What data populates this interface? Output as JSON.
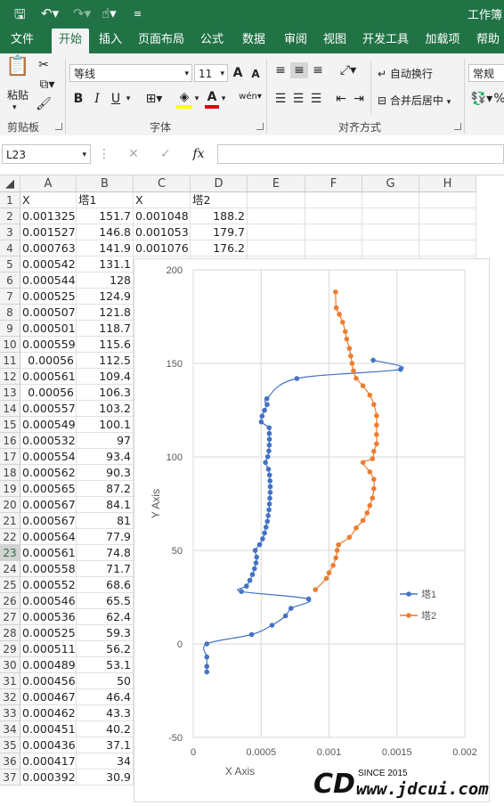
{
  "window": {
    "title": "工作簿"
  },
  "ribbon_tabs": [
    "文件",
    "开始",
    "插入",
    "页面布局",
    "公式",
    "数据",
    "审阅",
    "视图",
    "开发工具",
    "加载项",
    "帮助"
  ],
  "ribbon": {
    "paste_label": "粘贴",
    "clipboard_label": "剪贴板",
    "font_label": "字体",
    "align_label": "对齐方式",
    "font_name": "等线",
    "font_size": "11",
    "bold": "B",
    "italic": "I",
    "underline": "U",
    "font_color_glyph": "A",
    "grow_font": "A",
    "shrink_font": "A",
    "phonetic_glyph": "wén",
    "wrap_text": "自动换行",
    "merge_center": "合并后居中",
    "number_format": "常规",
    "accent_color": "#217346"
  },
  "formula_bar": {
    "name_box": "L23",
    "fx_label": "fx",
    "formula": ""
  },
  "columns": [
    "A",
    "B",
    "C",
    "D",
    "E",
    "F",
    "G",
    "H"
  ],
  "selected_row": 23,
  "rows": [
    {
      "n": "1",
      "a": "X",
      "b": "塔1",
      "c": "X",
      "d": "塔2"
    },
    {
      "n": "2",
      "a": "0.001325",
      "b": "151.7",
      "c": "0.001048",
      "d": "188.2"
    },
    {
      "n": "3",
      "a": "0.001527",
      "b": "146.8",
      "c": "0.001053",
      "d": "179.7"
    },
    {
      "n": "4",
      "a": "0.000763",
      "b": "141.9",
      "c": "0.001076",
      "d": "176.2"
    },
    {
      "n": "5",
      "a": "0.000542",
      "b": "131.1"
    },
    {
      "n": "6",
      "a": "0.000544",
      "b": "128"
    },
    {
      "n": "7",
      "a": "0.000525",
      "b": "124.9"
    },
    {
      "n": "8",
      "a": "0.000507",
      "b": "121.8"
    },
    {
      "n": "9",
      "a": "0.000501",
      "b": "118.7"
    },
    {
      "n": "10",
      "a": "0.000559",
      "b": "115.6"
    },
    {
      "n": "11",
      "a": "0.00056",
      "b": "112.5"
    },
    {
      "n": "12",
      "a": "0.000561",
      "b": "109.4"
    },
    {
      "n": "13",
      "a": "0.00056",
      "b": "106.3"
    },
    {
      "n": "14",
      "a": "0.000557",
      "b": "103.2"
    },
    {
      "n": "15",
      "a": "0.000549",
      "b": "100.1"
    },
    {
      "n": "16",
      "a": "0.000532",
      "b": "97"
    },
    {
      "n": "17",
      "a": "0.000554",
      "b": "93.4"
    },
    {
      "n": "18",
      "a": "0.000562",
      "b": "90.3"
    },
    {
      "n": "19",
      "a": "0.000565",
      "b": "87.2"
    },
    {
      "n": "20",
      "a": "0.000567",
      "b": "84.1"
    },
    {
      "n": "21",
      "a": "0.000567",
      "b": "81"
    },
    {
      "n": "22",
      "a": "0.000564",
      "b": "77.9"
    },
    {
      "n": "23",
      "a": "0.000561",
      "b": "74.8"
    },
    {
      "n": "24",
      "a": "0.000558",
      "b": "71.7"
    },
    {
      "n": "25",
      "a": "0.000552",
      "b": "68.6"
    },
    {
      "n": "26",
      "a": "0.000546",
      "b": "65.5"
    },
    {
      "n": "27",
      "a": "0.000536",
      "b": "62.4"
    },
    {
      "n": "28",
      "a": "0.000525",
      "b": "59.3"
    },
    {
      "n": "29",
      "a": "0.000511",
      "b": "56.2"
    },
    {
      "n": "30",
      "a": "0.000489",
      "b": "53.1"
    },
    {
      "n": "31",
      "a": "0.000456",
      "b": "50"
    },
    {
      "n": "32",
      "a": "0.000467",
      "b": "46.4"
    },
    {
      "n": "33",
      "a": "0.000462",
      "b": "43.3"
    },
    {
      "n": "34",
      "a": "0.000451",
      "b": "40.2"
    },
    {
      "n": "35",
      "a": "0.000436",
      "b": "37.1"
    },
    {
      "n": "36",
      "a": "0.000417",
      "b": "34"
    },
    {
      "n": "37",
      "a": "0.000392",
      "b": "30.9"
    }
  ],
  "chart_data": {
    "type": "scatter",
    "xlabel": "X Axis",
    "ylabel": "Y Axis",
    "xlim": [
      0,
      0.002
    ],
    "ylim": [
      -50,
      200
    ],
    "x_ticks": [
      "0",
      "0.0005",
      "0.001",
      "0.0015",
      "0.002"
    ],
    "y_ticks": [
      "-50",
      "0",
      "50",
      "100",
      "150",
      "200"
    ],
    "legend_position": "right",
    "grid": true,
    "series": [
      {
        "name": "塔1",
        "color": "#4472C4",
        "points": [
          [
            0.001325,
            151.7
          ],
          [
            0.001527,
            146.8
          ],
          [
            0.000763,
            141.9
          ],
          [
            0.000542,
            131.1
          ],
          [
            0.000544,
            128
          ],
          [
            0.000525,
            124.9
          ],
          [
            0.000507,
            121.8
          ],
          [
            0.000501,
            118.7
          ],
          [
            0.000559,
            115.6
          ],
          [
            0.00056,
            112.5
          ],
          [
            0.000561,
            109.4
          ],
          [
            0.00056,
            106.3
          ],
          [
            0.000557,
            103.2
          ],
          [
            0.000549,
            100.1
          ],
          [
            0.000532,
            97
          ],
          [
            0.000554,
            93.4
          ],
          [
            0.000562,
            90.3
          ],
          [
            0.000565,
            87.2
          ],
          [
            0.000567,
            84.1
          ],
          [
            0.000567,
            81
          ],
          [
            0.000564,
            77.9
          ],
          [
            0.000561,
            74.8
          ],
          [
            0.000558,
            71.7
          ],
          [
            0.000552,
            68.6
          ],
          [
            0.000546,
            65.5
          ],
          [
            0.000536,
            62.4
          ],
          [
            0.000525,
            59.3
          ],
          [
            0.000511,
            56.2
          ],
          [
            0.000489,
            53.1
          ],
          [
            0.000456,
            50
          ],
          [
            0.000467,
            46.4
          ],
          [
            0.000462,
            43.3
          ],
          [
            0.000451,
            40.2
          ],
          [
            0.000436,
            37.1
          ],
          [
            0.000417,
            34
          ],
          [
            0.000392,
            30.9
          ],
          [
            0.000355,
            28
          ],
          [
            0.00085,
            24
          ],
          [
            0.00072,
            19
          ],
          [
            0.00068,
            15
          ],
          [
            0.00058,
            10
          ],
          [
            0.00043,
            5
          ],
          [
            0.0001,
            0
          ],
          [
            0.0001,
            -7
          ],
          [
            0.0001,
            -12
          ],
          [
            0.0001,
            -15
          ]
        ]
      },
      {
        "name": "塔2",
        "color": "#ED7D31",
        "points": [
          [
            0.001048,
            188.2
          ],
          [
            0.001053,
            179.7
          ],
          [
            0.001076,
            176.2
          ],
          [
            0.0011,
            172
          ],
          [
            0.00112,
            167
          ],
          [
            0.00113,
            163
          ],
          [
            0.00115,
            158
          ],
          [
            0.00116,
            154
          ],
          [
            0.00117,
            150
          ],
          [
            0.00118,
            146
          ],
          [
            0.0012,
            142
          ],
          [
            0.00125,
            138
          ],
          [
            0.0013,
            133
          ],
          [
            0.00133,
            128
          ],
          [
            0.00135,
            122
          ],
          [
            0.00135,
            117
          ],
          [
            0.00135,
            112
          ],
          [
            0.00135,
            107
          ],
          [
            0.00133,
            103
          ],
          [
            0.00132,
            99
          ],
          [
            0.00125,
            97
          ],
          [
            0.0013,
            92
          ],
          [
            0.00133,
            88
          ],
          [
            0.00133,
            83
          ],
          [
            0.00132,
            78
          ],
          [
            0.0013,
            74
          ],
          [
            0.00128,
            70
          ],
          [
            0.00125,
            66
          ],
          [
            0.0012,
            62
          ],
          [
            0.00115,
            57
          ],
          [
            0.00107,
            53
          ],
          [
            0.00106,
            50
          ],
          [
            0.00105,
            46
          ],
          [
            0.00103,
            42
          ],
          [
            0.001,
            38
          ],
          [
            0.00098,
            35
          ],
          [
            0.0009,
            29
          ]
        ]
      }
    ]
  },
  "watermark": {
    "logo": "CD",
    "since": "SINCE 2015",
    "url": "www.jdcui.com"
  }
}
